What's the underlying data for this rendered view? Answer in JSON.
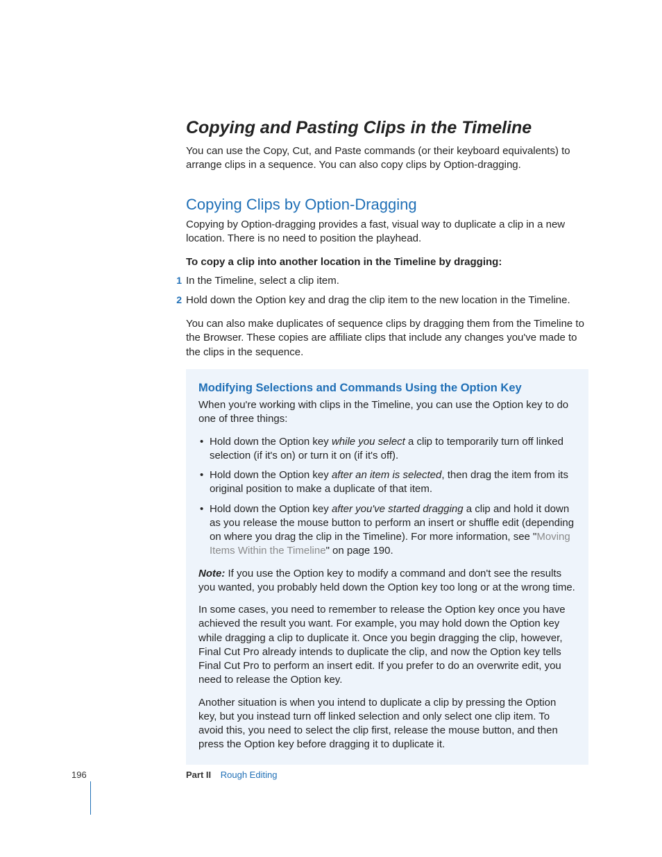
{
  "section": {
    "title": "Copying and Pasting Clips in the Timeline",
    "intro": "You can use the Copy, Cut, and Paste commands (or their keyboard equivalents) to arrange clips in a sequence. You can also copy clips by Option-dragging."
  },
  "subsection": {
    "title": "Copying Clips by Option-Dragging",
    "intro": "Copying by Option-dragging provides a fast, visual way to duplicate a clip in a new location. There is no need to position the playhead.",
    "lead": "To copy a clip into another location in the Timeline by dragging:",
    "steps": [
      {
        "num": "1",
        "text": "In the Timeline, select a clip item."
      },
      {
        "num": "2",
        "text": "Hold down the Option key and drag the clip item to the new location in the Timeline."
      }
    ],
    "after_steps": "You can also make duplicates of sequence clips by dragging them from the Timeline to the Browser. These copies are affiliate clips that include any changes you've made to the clips in the sequence."
  },
  "box": {
    "title": "Modifying Selections and Commands Using the Option Key",
    "intro": "When you're working with clips in the Timeline, you can use the Option key to do one of three things:",
    "bullets": {
      "b1": {
        "pre": "Hold down the Option key ",
        "em": "while you select",
        "post": " a clip to temporarily turn off linked selection (if it's on) or turn it on (if it's off)."
      },
      "b2": {
        "pre": "Hold down the Option key ",
        "em": "after an item is selected",
        "post": ", then drag the item from its original position to make a duplicate of that item."
      },
      "b3": {
        "pre": "Hold down the Option key ",
        "em": "after you've started dragging",
        "post1": " a clip and hold it down as you release the mouse button to perform an insert or shuffle edit (depending on where you drag the clip in the Timeline). For more information, see \"",
        "link": "Moving Items Within the Timeline",
        "post2": "\" on page 190."
      }
    },
    "note_label": "Note:",
    "note_text": "  If you use the Option key to modify a command and don't see the results you wanted, you probably held down the Option key too long or at the wrong time.",
    "para2": "In some cases, you need to remember to release the Option key once you have achieved the result you want. For example, you may hold down the Option key while dragging a clip to duplicate it. Once you begin dragging the clip, however, Final Cut Pro already intends to duplicate the clip, and now the Option key tells Final Cut Pro to perform an insert edit. If you prefer to do an overwrite edit, you need to release the Option key.",
    "para3": "Another situation is when you intend to duplicate a clip by pressing the Option key, but you instead turn off linked selection and only select one clip item. To avoid this, you need to select the clip first, release the mouse button, and then press the Option key before dragging it to duplicate it."
  },
  "footer": {
    "page": "196",
    "part_label": "Part II",
    "part_name": "Rough Editing"
  }
}
